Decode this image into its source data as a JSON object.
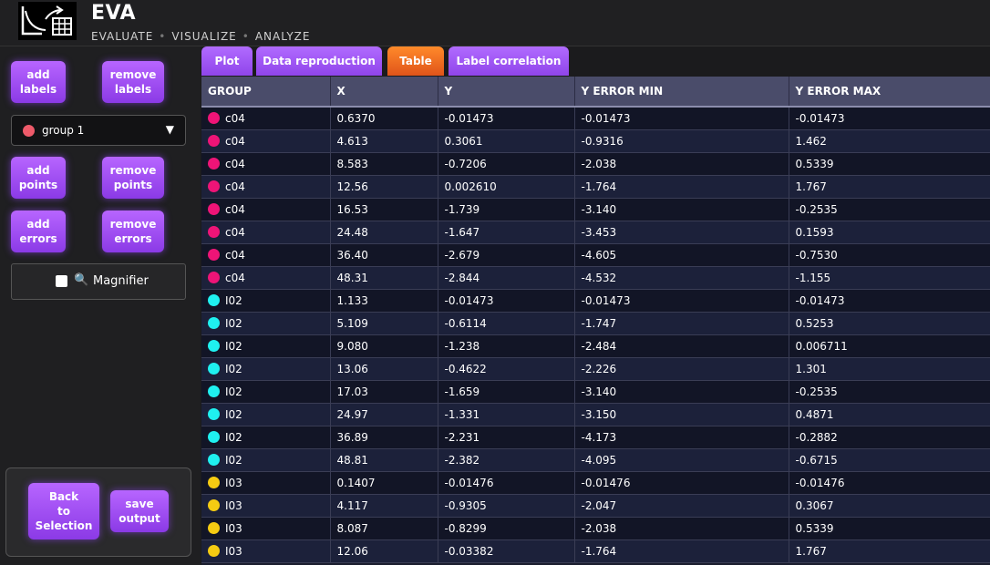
{
  "header": {
    "title": "EVA",
    "subtitle": [
      "EVALUATE",
      "VISUALIZE",
      "ANALYZE"
    ],
    "logo_icon": "chart-table-icon"
  },
  "sidebar": {
    "add_labels": "add\nlabels",
    "remove_labels": "remove\nlabels",
    "group_select": {
      "selected": "group 1",
      "color": "#ee5a6a"
    },
    "add_points": "add\npoints",
    "remove_points": "remove\npoints",
    "add_errors": "add\nerrors",
    "remove_errors": "remove\nerrors",
    "magnifier_label": "Magnifier",
    "back_to_selection": "Back\nto\nSelection",
    "save_output": "save\noutput"
  },
  "tabs": [
    {
      "label": "Plot",
      "active": false
    },
    {
      "label": "Data reproduction",
      "active": false
    },
    {
      "label": "Table",
      "active": true
    },
    {
      "label": "Label correlation",
      "active": false
    }
  ],
  "table": {
    "columns": [
      "GROUP",
      "X",
      "Y",
      "Y ERROR MIN",
      "Y ERROR MAX"
    ],
    "group_colors": {
      "c04": "#ee1477",
      "I02": "#1ff0f0",
      "I03": "#f5cb12"
    },
    "rows": [
      [
        "c04",
        "0.6370",
        "-0.01473",
        "-0.01473",
        "-0.01473"
      ],
      [
        "c04",
        "4.613",
        "0.3061",
        "-0.9316",
        "1.462"
      ],
      [
        "c04",
        "8.583",
        "-0.7206",
        "-2.038",
        "0.5339"
      ],
      [
        "c04",
        "12.56",
        "0.002610",
        "-1.764",
        "1.767"
      ],
      [
        "c04",
        "16.53",
        "-1.739",
        "-3.140",
        "-0.2535"
      ],
      [
        "c04",
        "24.48",
        "-1.647",
        "-3.453",
        "0.1593"
      ],
      [
        "c04",
        "36.40",
        "-2.679",
        "-4.605",
        "-0.7530"
      ],
      [
        "c04",
        "48.31",
        "-2.844",
        "-4.532",
        "-1.155"
      ],
      [
        "I02",
        "1.133",
        "-0.01473",
        "-0.01473",
        "-0.01473"
      ],
      [
        "I02",
        "5.109",
        "-0.6114",
        "-1.747",
        "0.5253"
      ],
      [
        "I02",
        "9.080",
        "-1.238",
        "-2.484",
        "0.006711"
      ],
      [
        "I02",
        "13.06",
        "-0.4622",
        "-2.226",
        "1.301"
      ],
      [
        "I02",
        "17.03",
        "-1.659",
        "-3.140",
        "-0.2535"
      ],
      [
        "I02",
        "24.97",
        "-1.331",
        "-3.150",
        "0.4871"
      ],
      [
        "I02",
        "36.89",
        "-2.231",
        "-4.173",
        "-0.2882"
      ],
      [
        "I02",
        "48.81",
        "-2.382",
        "-4.095",
        "-0.6715"
      ],
      [
        "I03",
        "0.1407",
        "-0.01476",
        "-0.01476",
        "-0.01476"
      ],
      [
        "I03",
        "4.117",
        "-0.9305",
        "-2.047",
        "0.3067"
      ],
      [
        "I03",
        "8.087",
        "-0.8299",
        "-2.038",
        "0.5339"
      ],
      [
        "I03",
        "12.06",
        "-0.03382",
        "-1.764",
        "1.767"
      ]
    ]
  }
}
